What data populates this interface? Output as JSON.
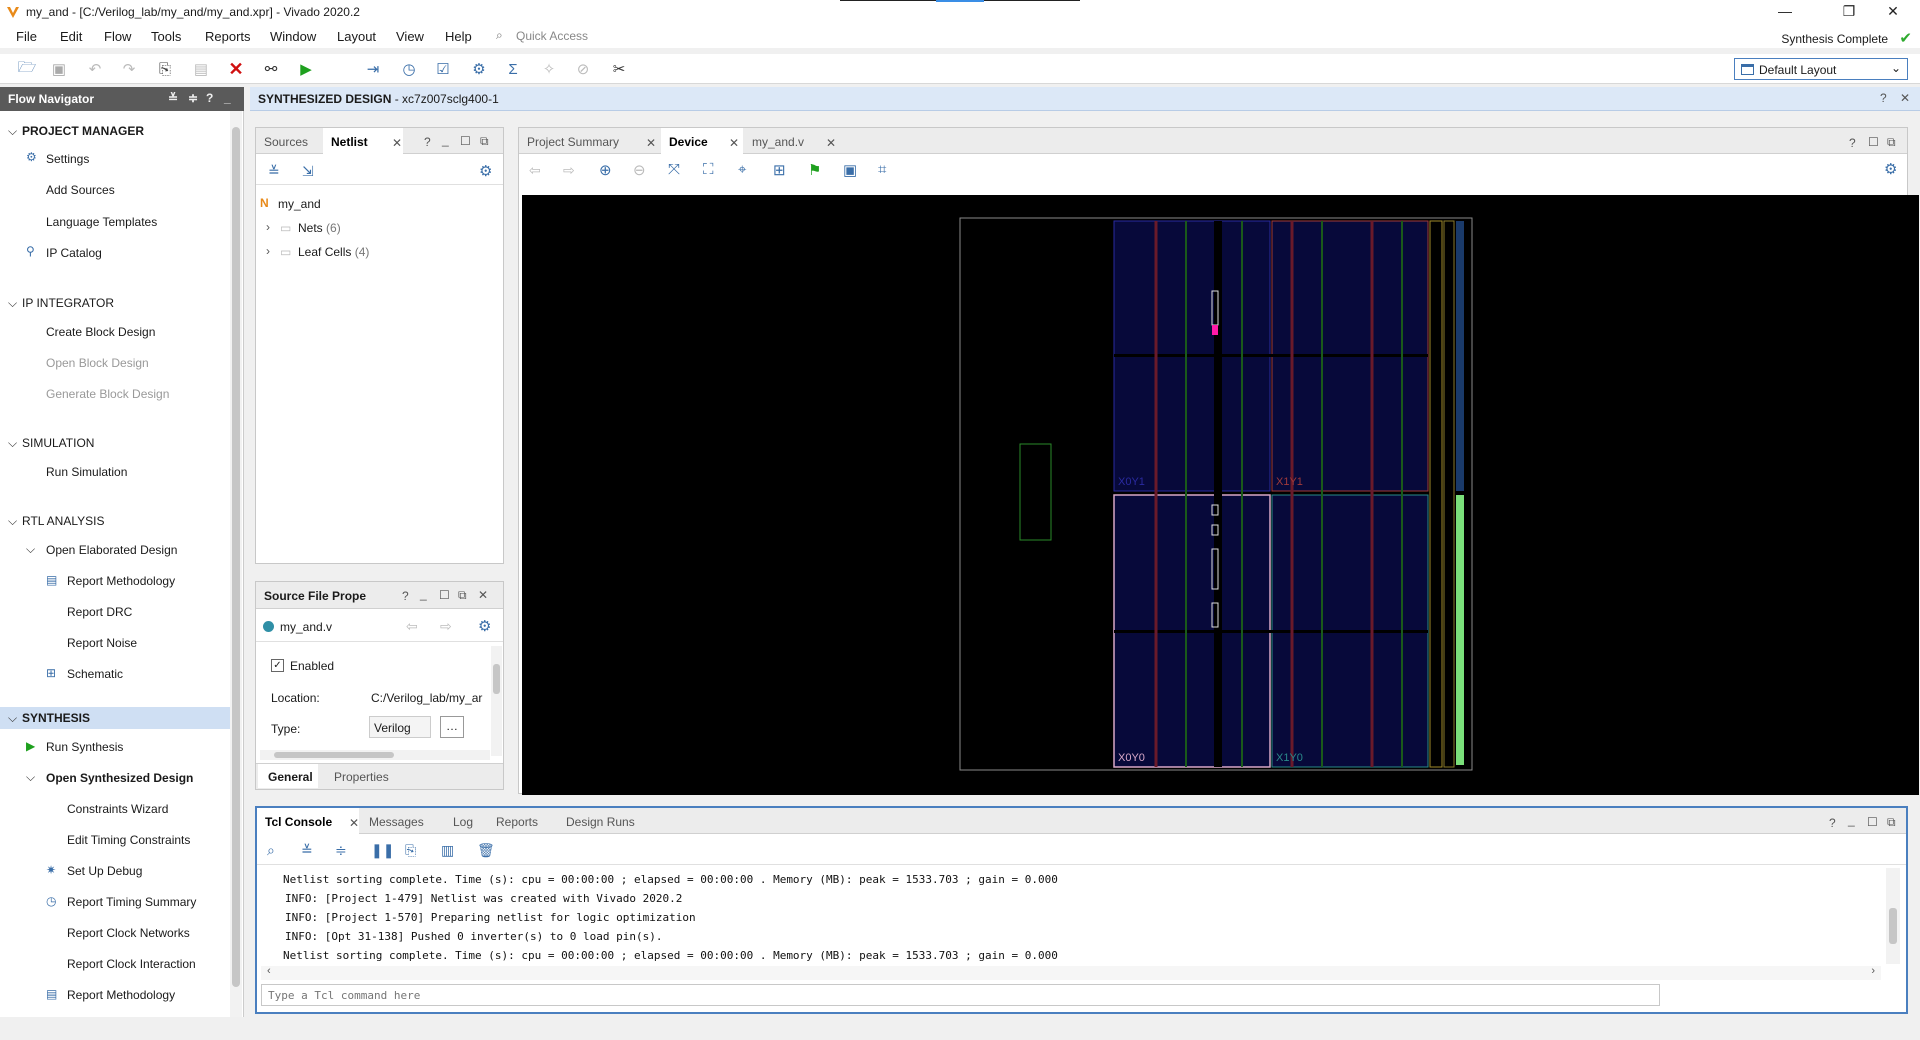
{
  "window": {
    "title": "my_and - [C:/Verilog_lab/my_and/my_and.xpr] - Vivado 2020.2",
    "minimize": "—",
    "maximize": "❐",
    "close": "✕"
  },
  "menu": [
    "File",
    "Edit",
    "Flow",
    "Tools",
    "Reports",
    "Window",
    "Layout",
    "View",
    "Help"
  ],
  "quick_access": {
    "placeholder": "Quick Access"
  },
  "status": {
    "text": "Synthesis Complete",
    "color": "#2eaa2e"
  },
  "layout_select": {
    "value": "Default Layout"
  },
  "flow_navigator": {
    "title": "Flow Navigator",
    "sections": [
      {
        "label": "PROJECT MANAGER",
        "items": [
          {
            "label": "Settings",
            "icon": "gear-icon"
          },
          {
            "label": "Add Sources"
          },
          {
            "label": "Language Templates"
          },
          {
            "label": "IP Catalog",
            "icon": "ip-icon"
          }
        ]
      },
      {
        "label": "IP INTEGRATOR",
        "items": [
          {
            "label": "Create Block Design"
          },
          {
            "label": "Open Block Design",
            "disabled": true
          },
          {
            "label": "Generate Block Design",
            "disabled": true
          }
        ]
      },
      {
        "label": "SIMULATION",
        "items": [
          {
            "label": "Run Simulation"
          }
        ]
      },
      {
        "label": "RTL ANALYSIS",
        "items": [
          {
            "label": "Open Elaborated Design"
          },
          {
            "label": "Report Methodology"
          },
          {
            "label": "Report DRC"
          },
          {
            "label": "Report Noise"
          },
          {
            "label": "Schematic"
          }
        ]
      },
      {
        "label": "SYNTHESIS",
        "items": [
          {
            "label": "Run Synthesis"
          },
          {
            "label": "Open Synthesized Design"
          },
          {
            "label": "Constraints Wizard"
          },
          {
            "label": "Edit Timing Constraints"
          },
          {
            "label": "Set Up Debug"
          },
          {
            "label": "Report Timing Summary"
          },
          {
            "label": "Report Clock Networks"
          },
          {
            "label": "Report Clock Interaction"
          },
          {
            "label": "Report Methodology"
          }
        ]
      }
    ]
  },
  "design_header": {
    "title": "SYNTHESIZED DESIGN",
    "part": " - xc7z007sclg400-1"
  },
  "sources_panel": {
    "tabs": [
      "Sources",
      "Netlist"
    ],
    "active_tab": "Netlist",
    "top": "my_and",
    "nets": {
      "label": "Nets",
      "count": "(6)"
    },
    "cells": {
      "label": "Leaf Cells",
      "count": "(4)"
    }
  },
  "props_panel": {
    "title": "Source File Prope",
    "file": "my_and.v",
    "enabled_label": "Enabled",
    "location_label": "Location:",
    "location_value": "C:/Verilog_lab/my_ar",
    "type_label": "Type:",
    "type_value": "Verilog",
    "more": "…",
    "tabs": [
      "General",
      "Properties"
    ]
  },
  "device_panel": {
    "tabs": [
      "Project Summary",
      "Device",
      "my_and.v"
    ],
    "active_tab": "Device",
    "regions": [
      "X0Y1",
      "X1Y1",
      "X0Y0",
      "X1Y0"
    ]
  },
  "console": {
    "tabs": [
      "Tcl Console",
      "Messages",
      "Log",
      "Reports",
      "Design Runs"
    ],
    "lines": [
      "Netlist sorting complete. Time (s): cpu = 00:00:00 ; elapsed = 00:00:00 . Memory (MB): peak = 1533.703 ; gain = 0.000",
      "INFO: [Project 1-479] Netlist was created with Vivado 2020.2",
      "INFO: [Project 1-570] Preparing netlist for logic optimization",
      "INFO: [Opt 31-138] Pushed 0 inverter(s) to 0 load pin(s).",
      "Netlist sorting complete. Time (s): cpu = 00:00:00 ; elapsed = 00:00:00 . Memory (MB): peak = 1533.703 ; gain = 0.000"
    ],
    "input_placeholder": "Type a Tcl command here"
  }
}
